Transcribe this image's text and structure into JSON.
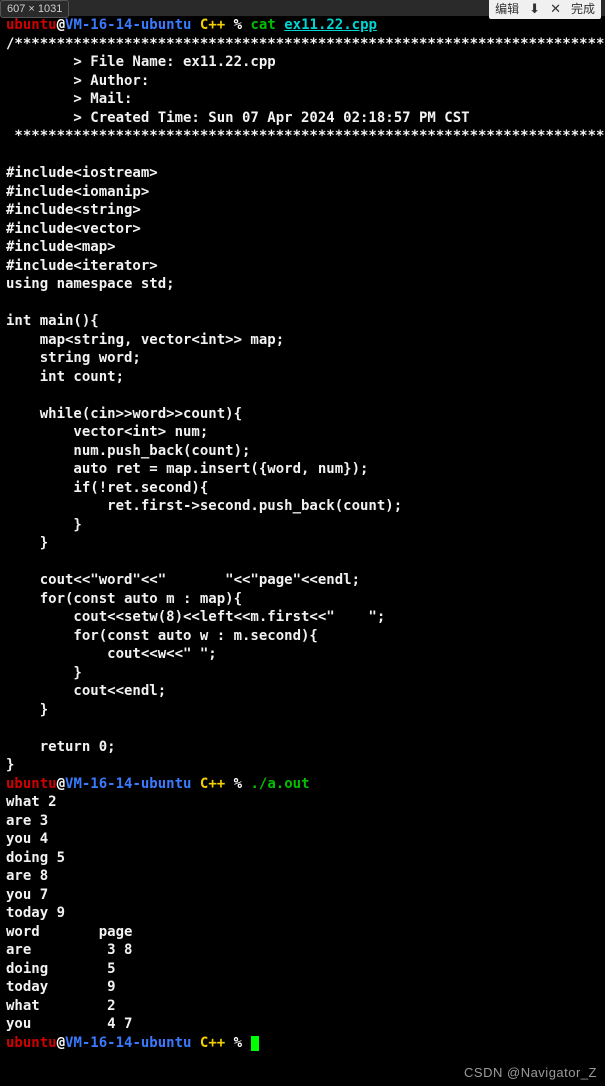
{
  "dims_badge": "607 × 1031",
  "toolbar": {
    "edit_label": "编辑",
    "download_icon": "download",
    "close_icon": "close",
    "done_label": "完成"
  },
  "prompt1": {
    "user": "ubuntu",
    "at": "@",
    "host": "VM-16-14-ubuntu",
    "dir": "C++",
    "pct": "%",
    "cmd": "cat",
    "arg": "ex11.22.cpp"
  },
  "file_header": {
    "top": "/*************************************************************************",
    "l1": "        > File Name: ex11.22.cpp",
    "l2": "        > Author:",
    "l3": "        > Mail:",
    "l4": "        > Created Time: Sun 07 Apr 2024 02:18:57 PM CST",
    "bottom": " ************************************************************************/"
  },
  "code": {
    "l01": "#include<iostream>",
    "l02": "#include<iomanip>",
    "l03": "#include<string>",
    "l04": "#include<vector>",
    "l05": "#include<map>",
    "l06": "#include<iterator>",
    "l07": "using namespace std;",
    "l08": "",
    "l09": "int main(){",
    "l10": "    map<string, vector<int>> map;",
    "l11": "    string word;",
    "l12": "    int count;",
    "l13": "",
    "l14": "    while(cin>>word>>count){",
    "l15": "        vector<int> num;",
    "l16": "        num.push_back(count);",
    "l17": "        auto ret = map.insert({word, num});",
    "l18": "        if(!ret.second){",
    "l19": "            ret.first->second.push_back(count);",
    "l20": "        }",
    "l21": "    }",
    "l22": "",
    "l23": "    cout<<\"word\"<<\"       \"<<\"page\"<<endl;",
    "l24": "    for(const auto m : map){",
    "l25": "        cout<<setw(8)<<left<<m.first<<\"    \";",
    "l26": "        for(const auto w : m.second){",
    "l27": "            cout<<w<<\" \";",
    "l28": "        }",
    "l29": "        cout<<endl;",
    "l30": "    }",
    "l31": "",
    "l32": "    return 0;",
    "l33": "}"
  },
  "prompt2": {
    "user": "ubuntu",
    "at": "@",
    "host": "VM-16-14-ubuntu",
    "dir": "C++",
    "pct": "%",
    "run": "./a.out"
  },
  "io": {
    "in1": "what 2",
    "in2": "are 3",
    "in3": "you 4",
    "in4": "doing 5",
    "in5": "are 8",
    "in6": "you 7",
    "in7": "today 9",
    "out_hdr": "word       page",
    "out1": "are         3 8 ",
    "out2": "doing       5 ",
    "out3": "today       9 ",
    "out4": "what        2 ",
    "out5": "you         4 7 "
  },
  "prompt3": {
    "user": "ubuntu",
    "at": "@",
    "host": "VM-16-14-ubuntu",
    "dir": "C++",
    "pct": "%"
  },
  "watermark": "CSDN @Navigator_Z"
}
